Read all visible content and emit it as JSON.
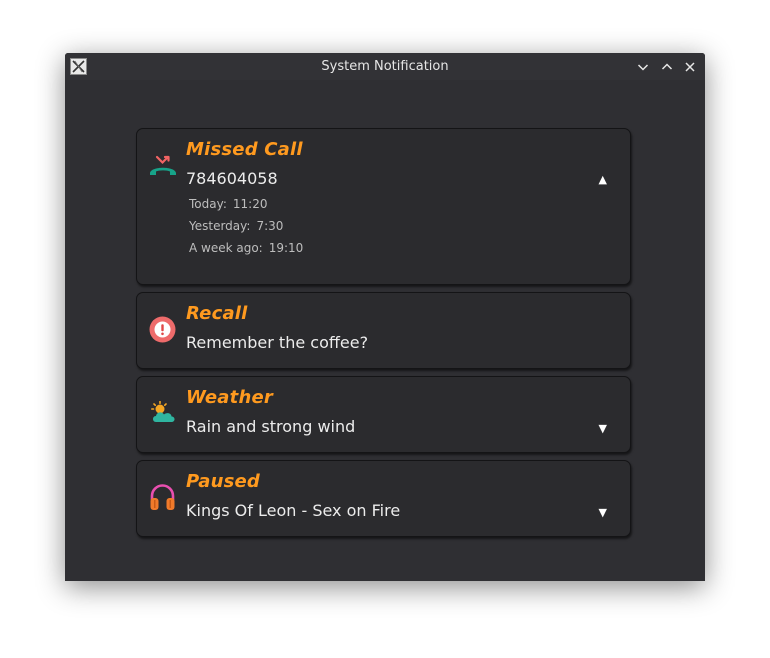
{
  "window": {
    "title": "System Notification"
  },
  "notifications": [
    {
      "title": "Missed Call",
      "body": "784604058",
      "icon": "missed-call-icon",
      "expanded": true,
      "details": [
        {
          "label": "Today:",
          "time": "11:20"
        },
        {
          "label": "Yesterday:",
          "time": "7:30"
        },
        {
          "label": "A week ago:",
          "time": "19:10"
        }
      ]
    },
    {
      "title": "Recall",
      "body": "Remember the coffee?",
      "icon": "alert-icon"
    },
    {
      "title": "Weather",
      "body": "Rain and strong wind",
      "icon": "weather-icon"
    },
    {
      "title": "Paused",
      "body": "Kings Of Leon - Sex on Fire",
      "icon": "headphones-icon"
    }
  ],
  "colors": {
    "accent": "#ff9a1f",
    "window_bg": "#2f2f33",
    "card_bg": "#2b2b2e",
    "text": "#ececec"
  }
}
